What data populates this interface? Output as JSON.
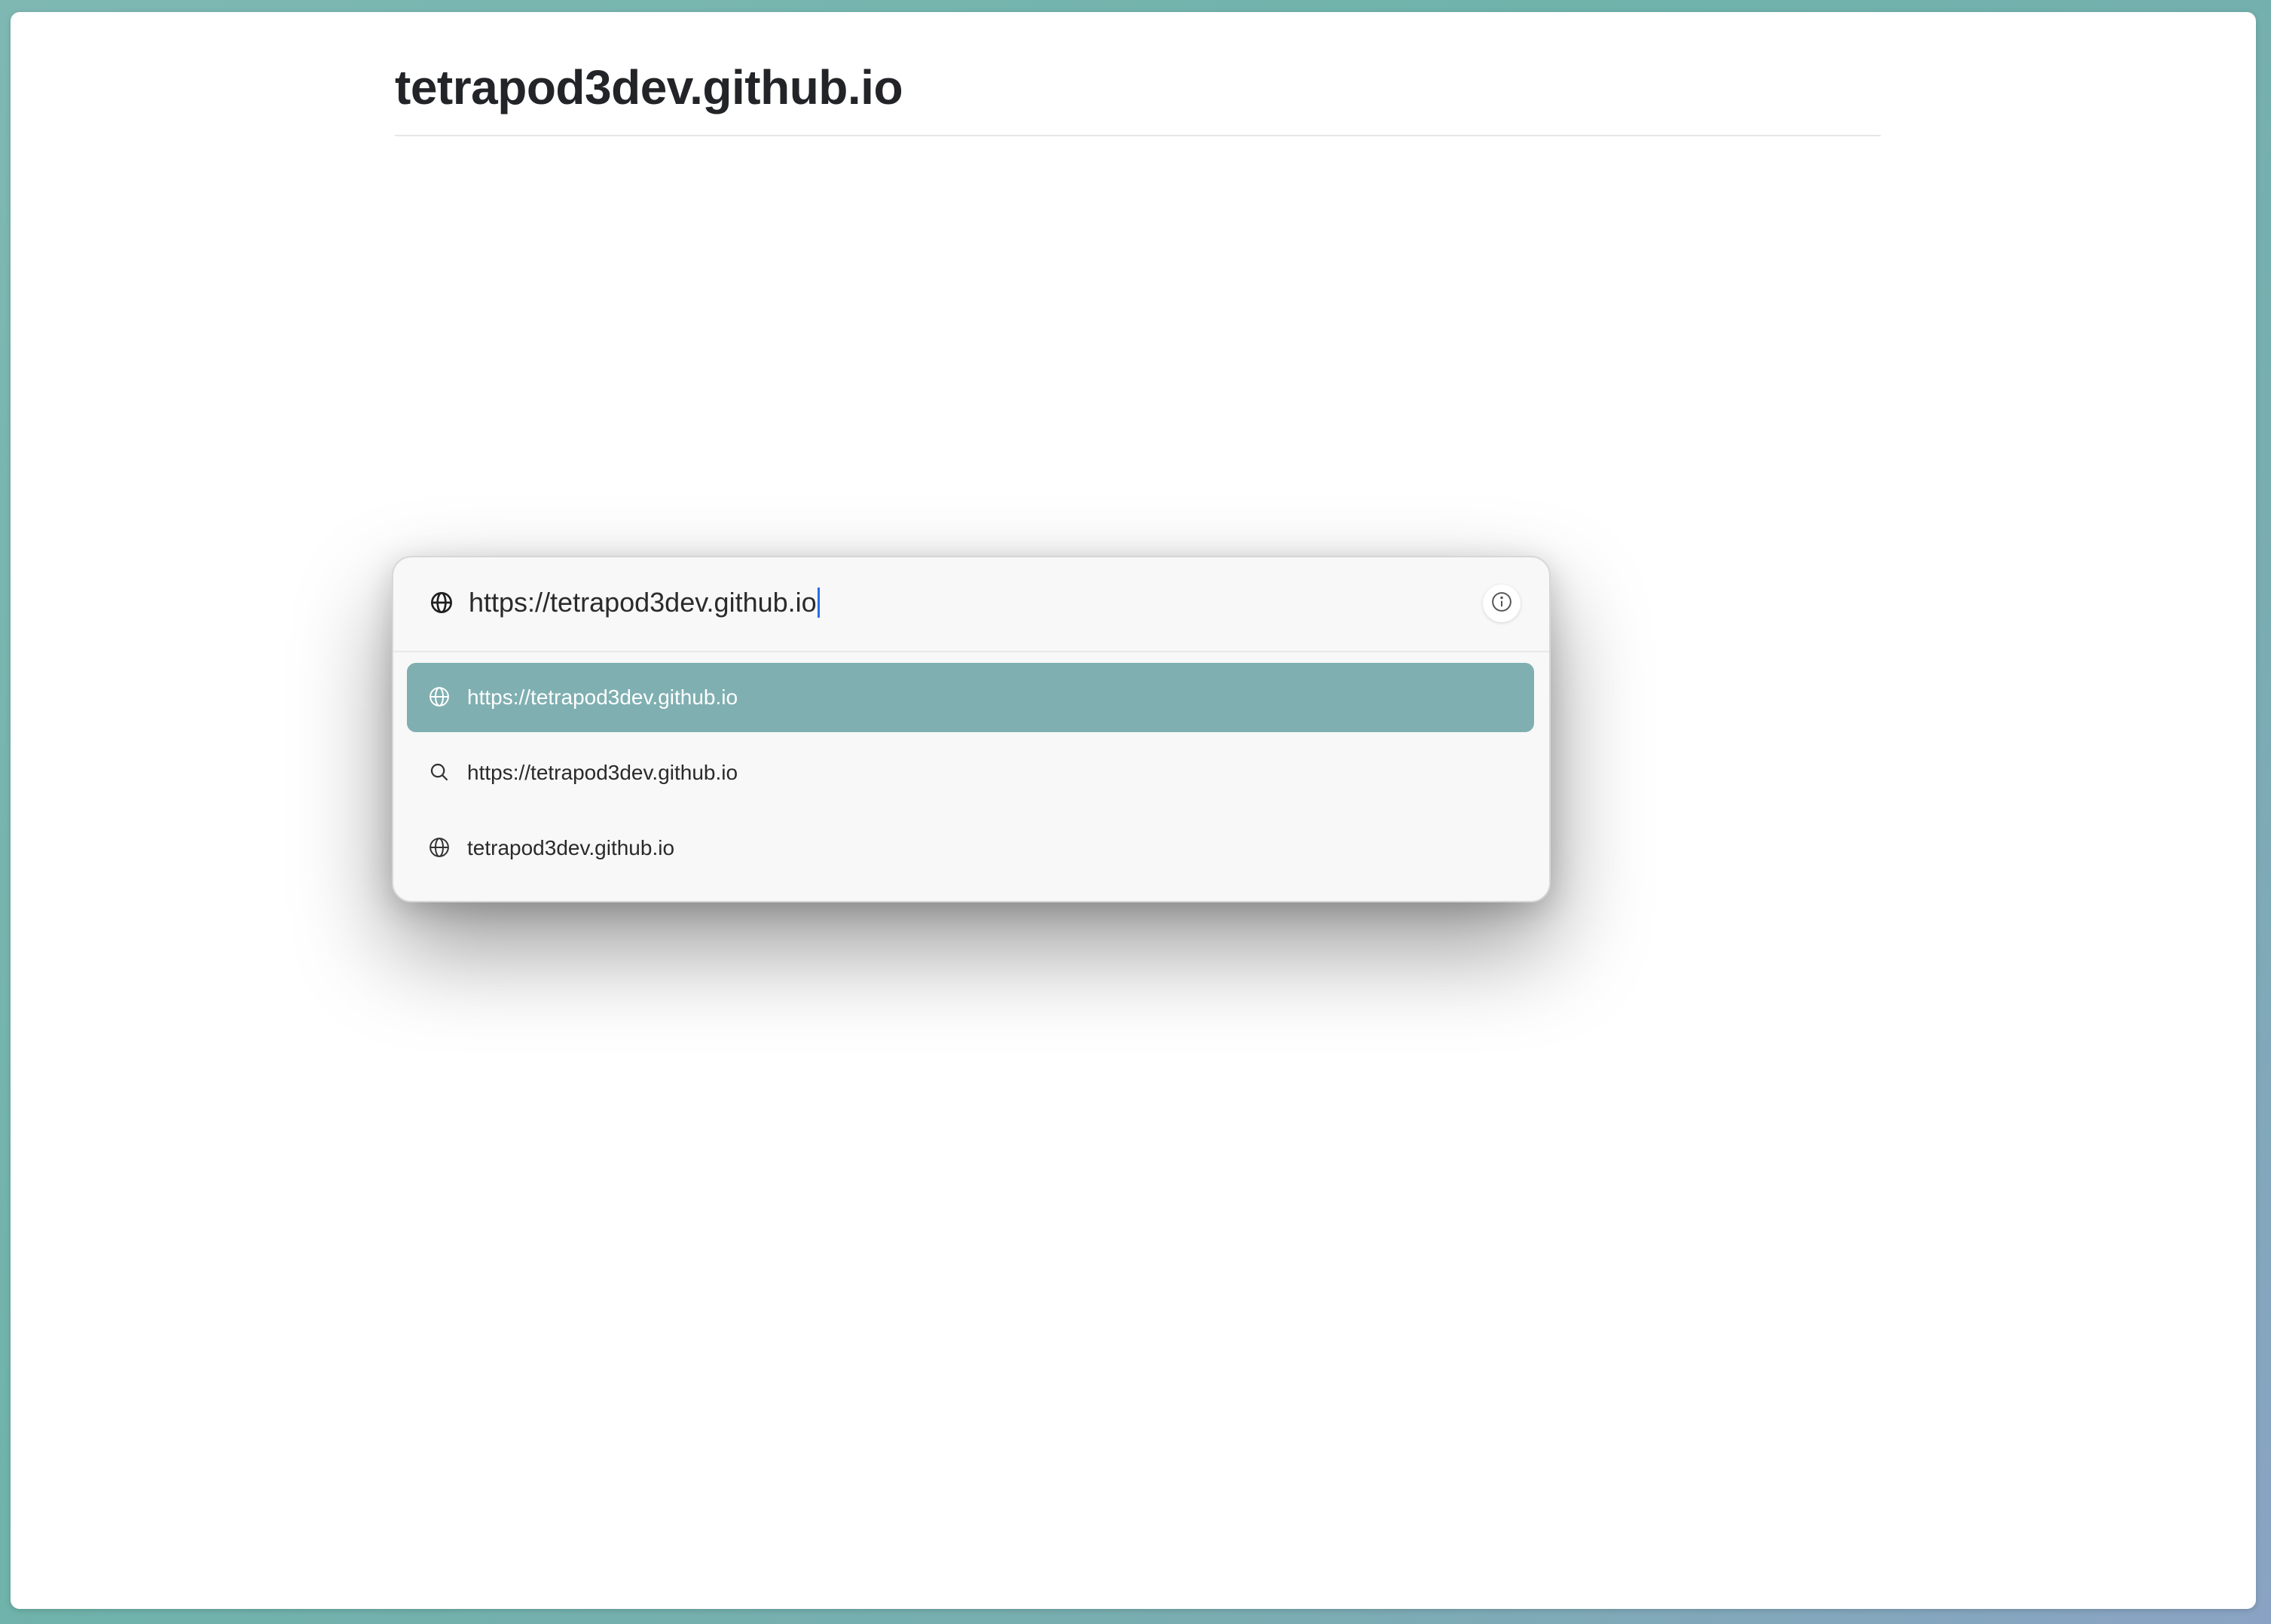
{
  "page": {
    "title": "tetrapod3dev.github.io"
  },
  "palette": {
    "input_value": "https://tetrapod3dev.github.io",
    "input_icon": "globe-icon",
    "info_icon": "info-circle-icon",
    "results": [
      {
        "label": "https://tetrapod3dev.github.io",
        "icon": "globe-icon",
        "selected": true
      },
      {
        "label": "https://tetrapod3dev.github.io",
        "icon": "search-icon",
        "selected": false
      },
      {
        "label": "tetrapod3dev.github.io",
        "icon": "globe-icon",
        "selected": false
      }
    ]
  },
  "colors": {
    "selected_row": "#7fafb1",
    "caret": "#2a6ee8",
    "background_teal": "#6fb3ab"
  }
}
